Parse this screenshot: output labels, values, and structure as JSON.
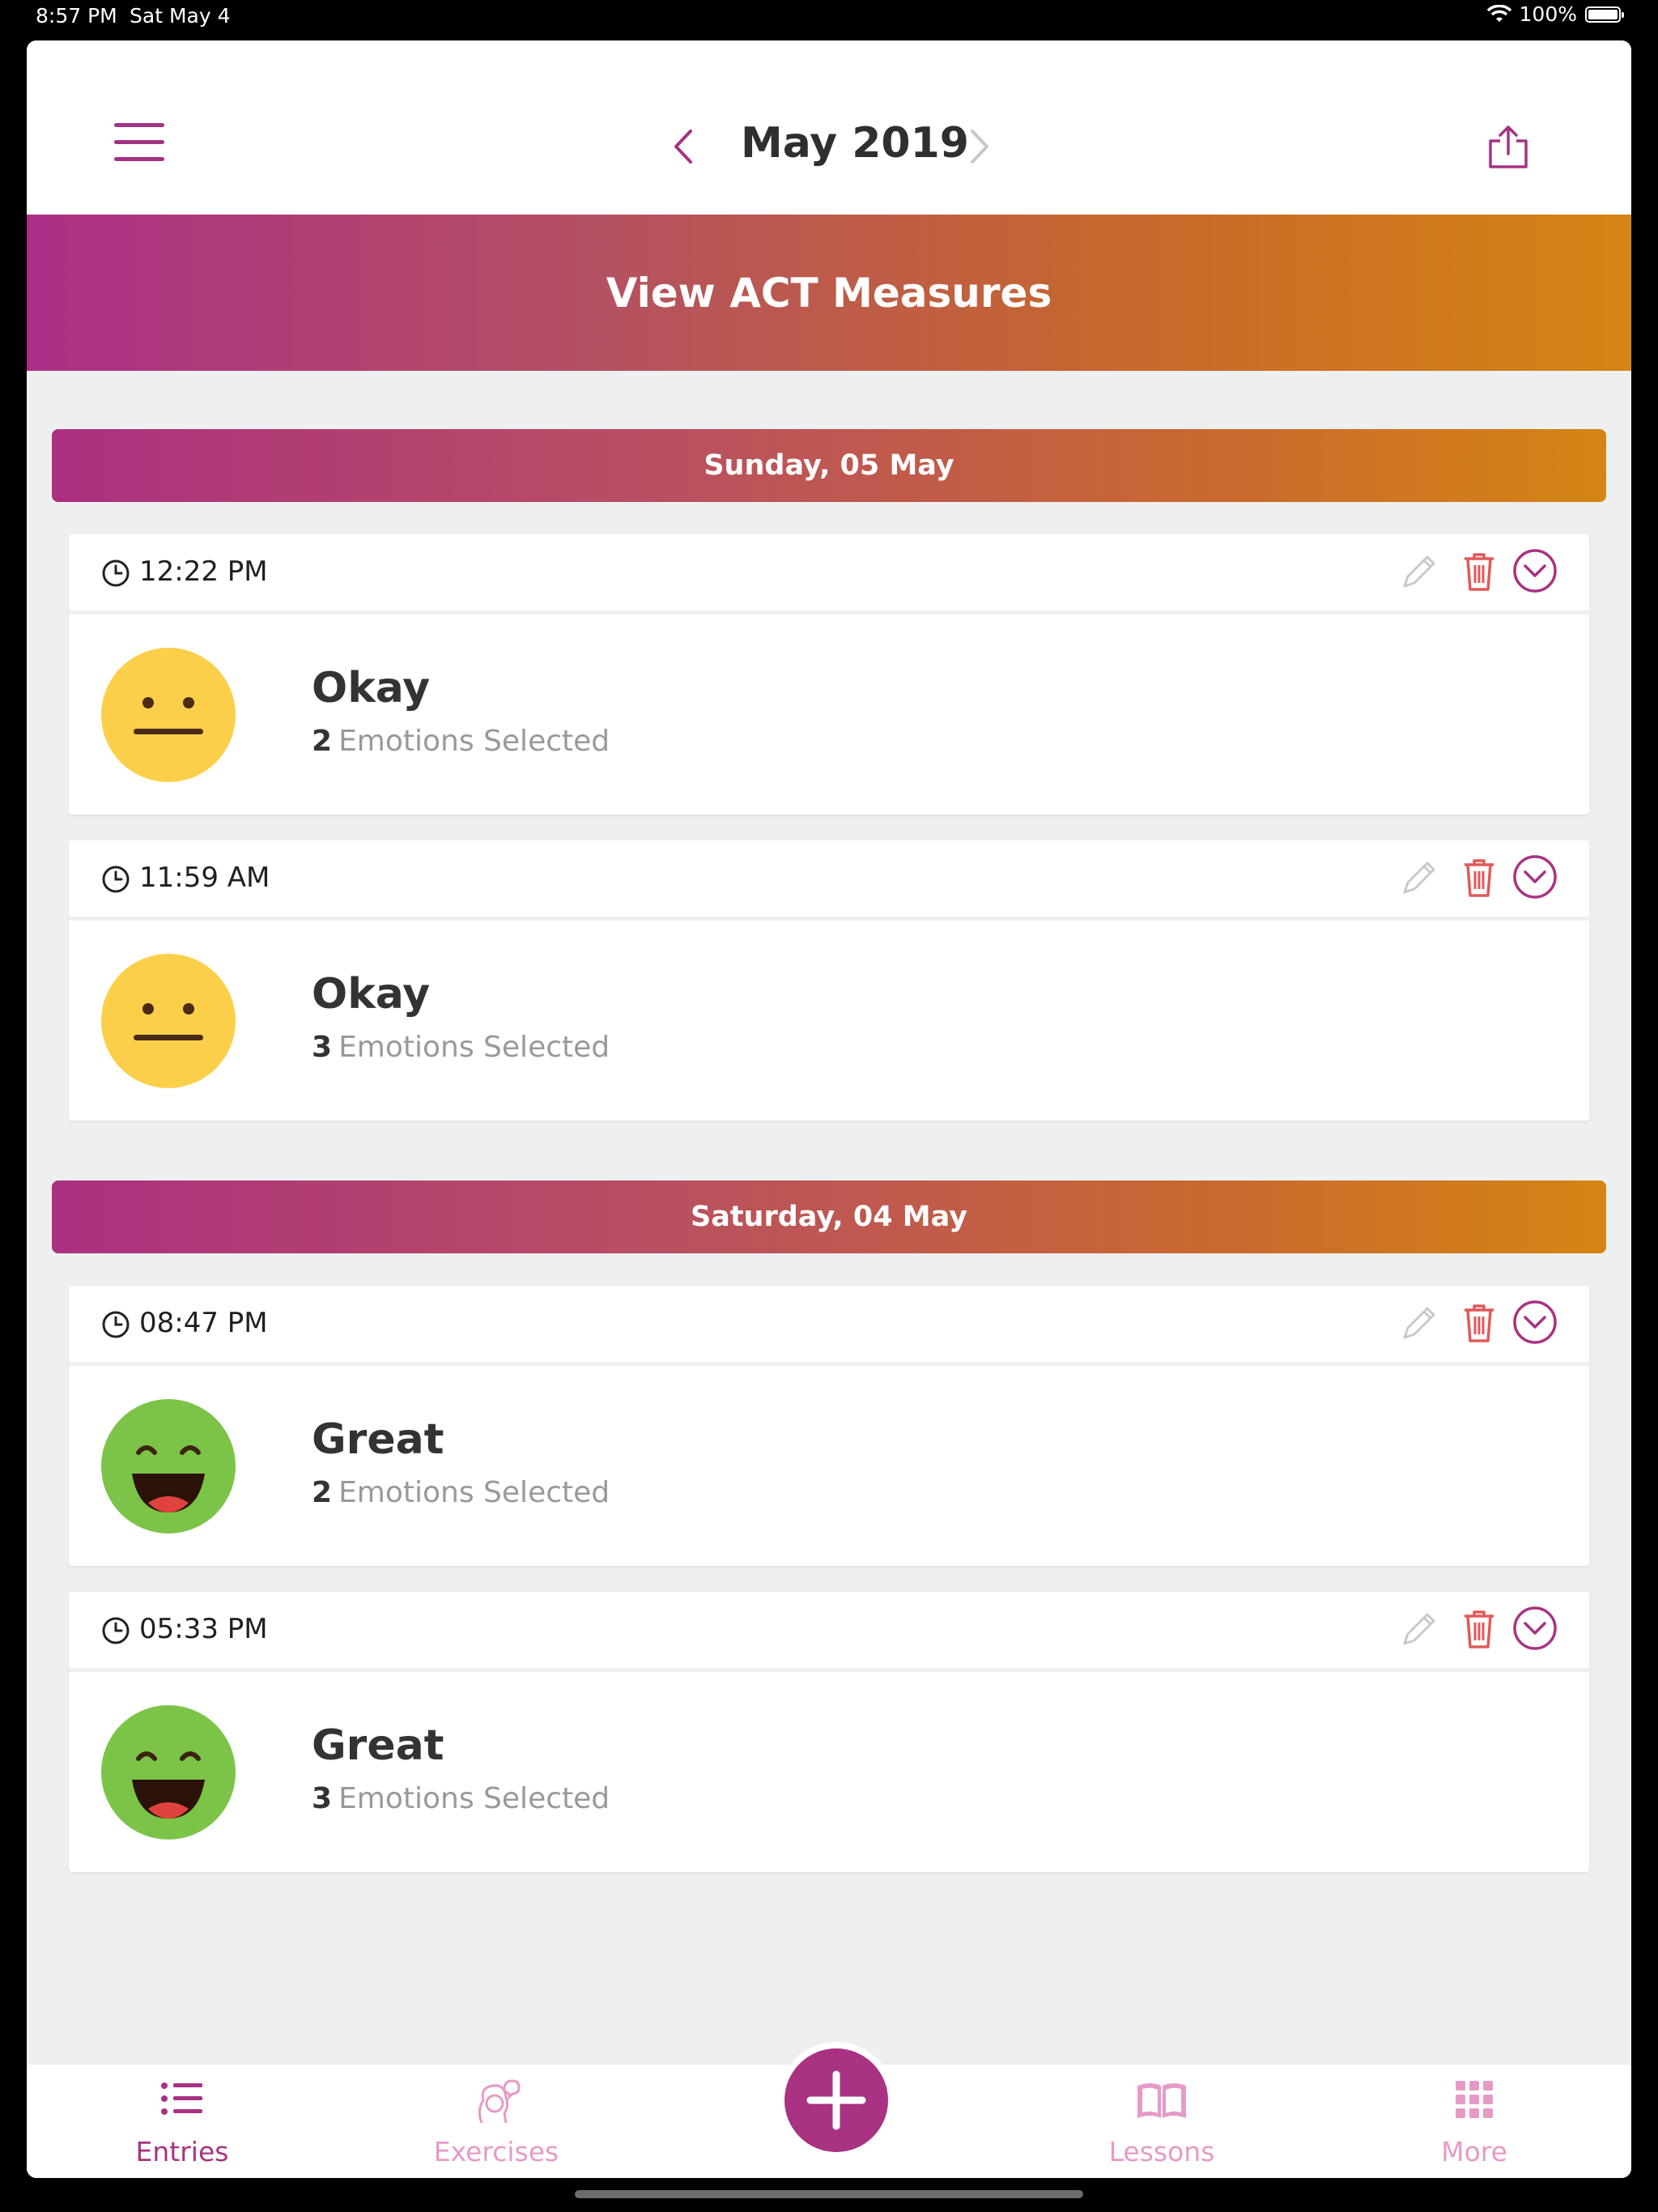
{
  "status_bar": {
    "time": "8:57 PM",
    "date": "Sat May 4",
    "battery": "100%"
  },
  "header": {
    "month": "May 2019"
  },
  "banner": {
    "label": "View ACT Measures"
  },
  "days": [
    {
      "label": "Sunday, 05 May",
      "entries": [
        {
          "time": "12:22 PM",
          "mood": "Okay",
          "count": "2",
          "emotions_text": "Emotions Selected",
          "face": "neutral-face"
        },
        {
          "time": "11:59 AM",
          "mood": "Okay",
          "count": "3",
          "emotions_text": "Emotions Selected",
          "face": "neutral-face"
        }
      ]
    },
    {
      "label": "Saturday, 04 May",
      "entries": [
        {
          "time": "08:47 PM",
          "mood": "Great",
          "count": "2",
          "emotions_text": "Emotions Selected",
          "face": "happy-face"
        },
        {
          "time": "05:33 PM",
          "mood": "Great",
          "count": "3",
          "emotions_text": "Emotions Selected",
          "face": "happy-face"
        }
      ]
    }
  ],
  "tabs": {
    "entries": "Entries",
    "exercises": "Exercises",
    "lessons": "Lessons",
    "more": "More"
  },
  "colors": {
    "accent": "#a93282",
    "neutral_face": "#fccf4a",
    "happy_face": "#7cc447",
    "delete": "#e05a5a",
    "tab_inactive": "#e69ac8"
  }
}
